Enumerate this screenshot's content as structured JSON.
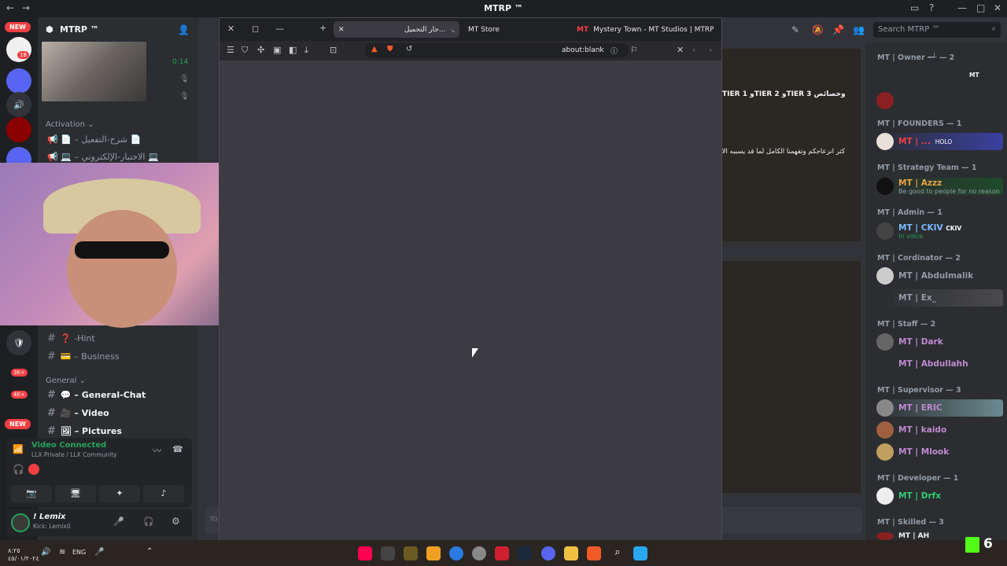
{
  "app": {
    "title": "MTRP ™"
  },
  "discord": {
    "server_name": "MTRP ™",
    "stream_timer": "0:14",
    "rail_badges": {
      "new_top": "NEW",
      "count_18": "18",
      "count_1": "1",
      "count_3k": "3K+",
      "count_4k": "4K+",
      "new_bottom": "NEW"
    },
    "categories": {
      "activation": "Activation",
      "general": "General"
    },
    "activation_channels": [
      "📢 📄 – شرح-التفعيل 📄",
      "📢 💻 – الاختبار-الإلكتروني 💻"
    ],
    "channels_mid": [
      {
        "label": "❓ -Hint"
      },
      {
        "label": "💳 – Business"
      }
    ],
    "general_channels": [
      {
        "label": "💬 – General-Chat"
      },
      {
        "label": "🎥 – Video"
      },
      {
        "label": "🖼 – Pictures"
      }
    ],
    "voice": {
      "status": "Video Connected",
      "location": "LLX Private / LLX Community"
    },
    "user": {
      "name": "! Lemix",
      "status": "Kick: Lemix0"
    },
    "search_placeholder": "Search MTRP ™",
    "chat_snippets": {
      "tier_line": "TIER 1 وTIER 2 وTIER 3 وخصائص",
      "body_line": "كثر انزعاجكم وتفهمنا الكامل لما قد يسببه الانتظار"
    },
    "message_placeholder": "Yo"
  },
  "members": {
    "groups": [
      {
        "label": "MT | Owner ━┵ — 2",
        "members": [
          {
            "name": "",
            "sub": "",
            "tag": "MT"
          },
          {
            "name": "",
            "sub": ""
          }
        ]
      },
      {
        "label": "MT | FOUNDERS — 1",
        "members": [
          {
            "name": "MT | ...",
            "tag": "HOLO"
          }
        ]
      },
      {
        "label": "MT | Strategy Team — 1",
        "members": [
          {
            "name": "MT | Azzz",
            "sub": "Be good to people for no reason"
          }
        ]
      },
      {
        "label": "MT | Admin — 1",
        "members": [
          {
            "name": "MT | CKIV",
            "tag": "CKIV",
            "sub": "In voice"
          }
        ]
      },
      {
        "label": "MT | Cordinator — 2",
        "members": [
          {
            "name": "MT | Abdulmalik"
          },
          {
            "name": "MT | Ex_"
          }
        ]
      },
      {
        "label": "MT | Staff — 2",
        "members": [
          {
            "name": "MT | Dark"
          },
          {
            "name": "MT | Abdullahh"
          }
        ]
      },
      {
        "label": "MT | Supervisor — 3",
        "members": [
          {
            "name": "MT | ERIC"
          },
          {
            "name": "MT | kaido"
          },
          {
            "name": "MT | Mlook"
          }
        ]
      },
      {
        "label": "MT | Developer — 1",
        "members": [
          {
            "name": "MT | Drfx"
          }
        ]
      },
      {
        "label": "MT | Skilled — 3",
        "members": [
          {
            "name": "MT | AH"
          }
        ]
      }
    ]
  },
  "browser": {
    "tabs": [
      {
        "label": "جار التحميل...",
        "active": true
      },
      {
        "label": "MT Store",
        "active": false
      },
      {
        "label": "Mystery Town - MT Studios | MTRP |",
        "active": false
      }
    ],
    "url": "about:blank"
  },
  "taskbar": {
    "lang": "ENG",
    "date": "٤٥/٠١/٢٠٢٤",
    "time": "٨:٢٥",
    "kick_count": "6"
  },
  "colors": {
    "discord_bg": "#313338",
    "sidebar_bg": "#2b2d31",
    "rail_bg": "#1e1f22",
    "accent_green": "#23a559",
    "kick_green": "#53fc18",
    "red": "#f23f43"
  }
}
